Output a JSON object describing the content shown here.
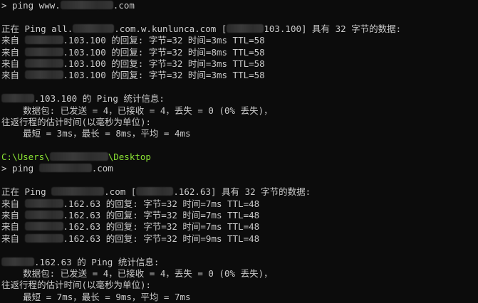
{
  "session1": {
    "command_prefix": "> ping www.",
    "command_suffix": ".com",
    "header_prefix": "正在 Ping all.",
    "header_mid": ".com.w.kunlunca.com [",
    "header_suffix": "103.100] 具有 32 字节的数据:",
    "replies": [
      {
        "prefix": "来自 ",
        "ip_suffix": ".103.100 的回复: 字节=32 时间=3ms TTL=58"
      },
      {
        "prefix": "来自 ",
        "ip_suffix": ".103.100 的回复: 字节=32 时间=8ms TTL=58"
      },
      {
        "prefix": "来自 ",
        "ip_suffix": ".103.100 的回复: 字节=32 时间=3ms TTL=58"
      },
      {
        "prefix": "来自 ",
        "ip_suffix": ".103.100 的回复: 字节=32 时间=3ms TTL=58"
      }
    ],
    "stats_title_suffix": ".103.100 的 Ping 统计信息:",
    "packets": "    数据包: 已发送 = 4，已接收 = 4，丢失 = 0 (0% 丢失)，",
    "rtt_title": "往返行程的估计时间(以毫秒为单位):",
    "rtt_values": "    最短 = 3ms，最长 = 8ms，平均 = 4ms"
  },
  "prompt": {
    "path_prefix": "C:\\Users\\",
    "path_suffix": "\\Desktop"
  },
  "session2": {
    "command_prefix": "> ping ",
    "command_suffix": ".com",
    "header_prefix": "正在 Ping ",
    "header_mid": ".com [",
    "header_suffix": ".162.63] 具有 32 字节的数据:",
    "replies": [
      {
        "prefix": "来自 ",
        "ip_suffix": ".162.63 的回复: 字节=32 时间=7ms TTL=48"
      },
      {
        "prefix": "来自 ",
        "ip_suffix": ".162.63 的回复: 字节=32 时间=7ms TTL=48"
      },
      {
        "prefix": "来自 ",
        "ip_suffix": ".162.63 的回复: 字节=32 时间=7ms TTL=48"
      },
      {
        "prefix": "来自 ",
        "ip_suffix": ".162.63 的回复: 字节=32 时间=9ms TTL=48"
      }
    ],
    "stats_title_suffix": ".162.63 的 Ping 统计信息:",
    "packets": "    数据包: 已发送 = 4，已接收 = 4，丢失 = 0 (0% 丢失)，",
    "rtt_title": "往返行程的估计时间(以毫秒为单位):",
    "rtt_values": "    最短 = 7ms，最长 = 9ms，平均 = 7ms"
  }
}
